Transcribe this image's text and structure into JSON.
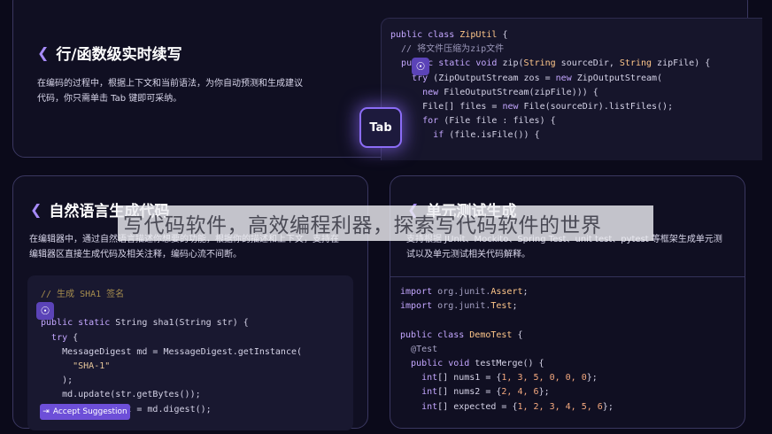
{
  "top_card": {
    "title": "行/函数级实时续写",
    "desc_line1": "在编码的过程中，根据上下文和当前语法，为你自动预测和生成建议",
    "desc_line2": "代码，你只需单击 Tab 键即可采纳。",
    "tab_key": "Tab",
    "code": [
      "public class ZipUtil {",
      "  // 将文件压缩为zip文件",
      "  public static void zip(String sourceDir, String zipFile) {",
      "    try (ZipOutputStream zos = new ZipOutputStream(",
      "      new FileOutputStream(zipFile))) {",
      "      File[] files = new File(sourceDir).listFiles();",
      "      for (File file : files) {",
      "        if (file.isFile()) {"
    ]
  },
  "left_card": {
    "title": "自然语言生成代码",
    "desc_line1": "在编辑器中，通过自然语言描述你想要的功能，根据你的描述和上下文，支持在",
    "desc_line2": "编辑器区直接生成代码及相关注释，编码心流不间断。",
    "accept_label": "Accept Suggestion",
    "code": [
      "// 生成 SHA1 签名",
      "",
      "public static String sha1(String str) {",
      "  try {",
      "    MessageDigest md = MessageDigest.getInstance(",
      "      \"SHA-1\"",
      "    );",
      "    md.update(str.getBytes());",
      "    byte[] digest = md.digest();"
    ]
  },
  "right_card": {
    "title": "单元测试生成",
    "desc_line1": "支持根据 JUnit、Mockito、Spring Test、unit test、pytest 等框架生成单元测",
    "desc_line2": "试以及单元测试相关代码解释。",
    "code": [
      "import org.junit.Assert;",
      "import org.junit.Test;",
      "",
      "public class DemoTest {",
      "  @Test",
      "  public void testMerge() {",
      "    int[] nums1 = {1, 3, 5, 0, 0, 0};",
      "    int[] nums2 = {2, 4, 6};",
      "    int[] expected = {1, 2, 3, 4, 5, 6};"
    ]
  },
  "watermark": "写代码软件，高效编程利器，探索写代码软件的世界",
  "colors": {
    "accent": "#8b6cf6",
    "background": "#0b0a1a",
    "button": "#6d4fd8"
  }
}
